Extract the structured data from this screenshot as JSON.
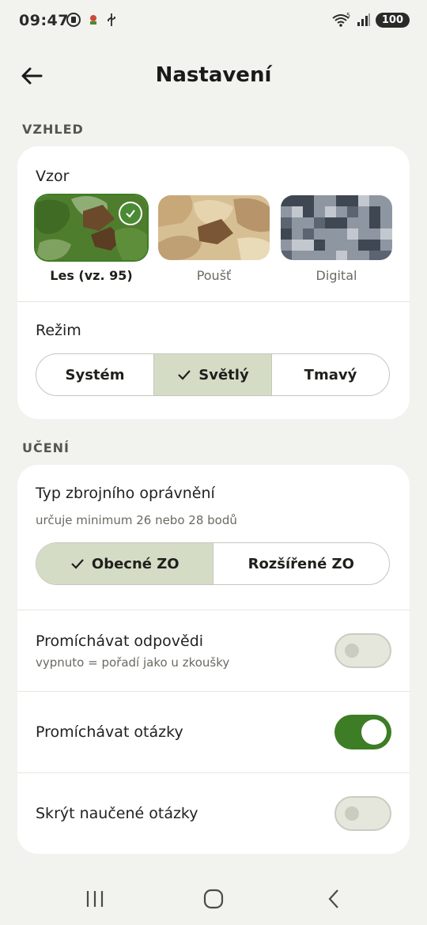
{
  "status": {
    "time": "09:47",
    "battery": "100"
  },
  "header": {
    "title": "Nastavení"
  },
  "appearance": {
    "section": "VZHLED",
    "pattern_label": "Vzor",
    "patterns": [
      {
        "name": "Les (vz. 95)",
        "selected": true
      },
      {
        "name": "Poušť",
        "selected": false
      },
      {
        "name": "Digital",
        "selected": false
      }
    ],
    "mode_label": "Režim",
    "modes": [
      "Systém",
      "Světlý",
      "Tmavý"
    ],
    "mode_selected": "Světlý"
  },
  "learning": {
    "section": "UČENÍ",
    "permit_label": "Typ zbrojního oprávnění",
    "permit_sub": "určuje minimum 26 nebo 28 bodů",
    "permit_options": [
      "Obecné ZO",
      "Rozšířené ZO"
    ],
    "permit_selected": "Obecné ZO",
    "shuffle_answers_label": "Promíchávat odpovědi",
    "shuffle_answers_sub": "vypnuto = pořadí jako u zkoušky",
    "shuffle_answers_on": false,
    "shuffle_questions_label": "Promíchávat otázky",
    "shuffle_questions_on": true,
    "hide_learned_label": "Skrýt naučené otázky",
    "hide_learned_on": false
  },
  "colors": {
    "accent": "#3c7d25",
    "selected_segment": "#d4dcc6",
    "background": "#f2f2ee"
  }
}
